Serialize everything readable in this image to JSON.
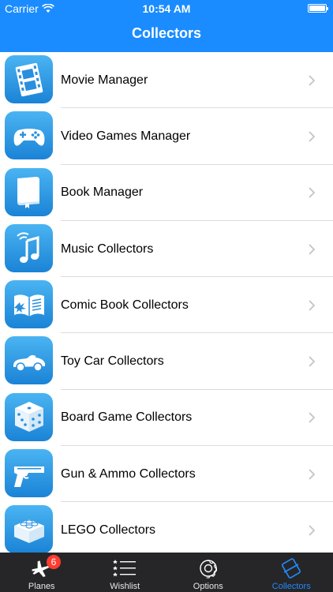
{
  "status_bar": {
    "carrier": "Carrier",
    "time": "10:54 AM"
  },
  "nav": {
    "title": "Collectors"
  },
  "list": {
    "items": [
      {
        "label": "Movie Manager",
        "icon": "film-strip-icon"
      },
      {
        "label": "Video Games Manager",
        "icon": "gamepad-icon"
      },
      {
        "label": "Book Manager",
        "icon": "book-icon"
      },
      {
        "label": "Music Collectors",
        "icon": "music-note-icon"
      },
      {
        "label": "Comic Book Collectors",
        "icon": "comic-book-icon"
      },
      {
        "label": "Toy Car Collectors",
        "icon": "toy-car-icon"
      },
      {
        "label": "Board Game Collectors",
        "icon": "dice-icon"
      },
      {
        "label": "Gun & Ammo Collectors",
        "icon": "pistol-icon"
      },
      {
        "label": "LEGO Collectors",
        "icon": "lego-brick-icon"
      }
    ]
  },
  "tabbar": {
    "tabs": [
      {
        "label": "Planes",
        "icon": "airplane-icon",
        "badge": "6"
      },
      {
        "label": "Wishlist",
        "icon": "star-list-icon"
      },
      {
        "label": "Options",
        "icon": "gear-icon"
      },
      {
        "label": "Collectors",
        "icon": "collectors-icon",
        "active": true
      }
    ]
  },
  "colors": {
    "nav_blue": "#1a8cff",
    "tabbar_bg": "#262628",
    "active_tab": "#1f8cff",
    "badge": "#ff3b30"
  }
}
